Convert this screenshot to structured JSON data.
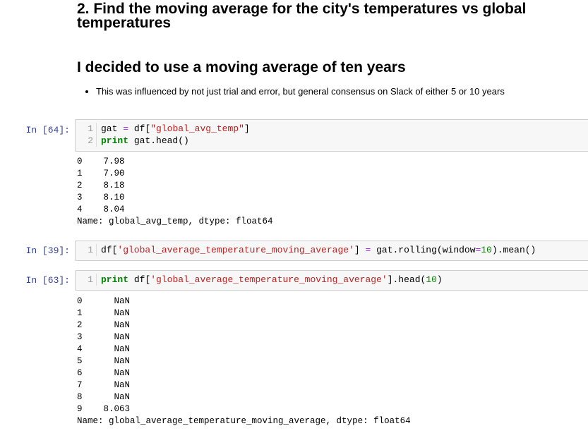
{
  "heading1": {
    "line1": "2. Find the moving average for the city's temperatures vs global",
    "line2": "temperatures"
  },
  "heading2": "I decided to use a moving average of ten years",
  "bullets": [
    "This was influenced by not just trial and error, but general consensus on Slack of either 5 or 10 years"
  ],
  "cells": {
    "cell1": {
      "prompt": "In [64]:",
      "lines": [
        {
          "num": "1",
          "parts": [
            {
              "t": "gat ",
              "c": ""
            },
            {
              "t": "=",
              "c": "op"
            },
            {
              "t": " df[",
              "c": ""
            },
            {
              "t": "\"global_avg_temp\"",
              "c": "str"
            },
            {
              "t": "]",
              "c": ""
            }
          ]
        },
        {
          "num": "2",
          "parts": [
            {
              "t": "print",
              "c": "kw"
            },
            {
              "t": " gat.head()",
              "c": ""
            }
          ]
        }
      ],
      "output": [
        "0    7.98",
        "1    7.90",
        "2    8.18",
        "3    8.10",
        "4    8.04",
        "Name: global_avg_temp, dtype: float64"
      ]
    },
    "cell2": {
      "prompt": "In [39]:",
      "lines": [
        {
          "num": "1",
          "parts": [
            {
              "t": "df[",
              "c": ""
            },
            {
              "t": "'global_average_temperature_moving_average'",
              "c": "str"
            },
            {
              "t": "] ",
              "c": ""
            },
            {
              "t": "=",
              "c": "op"
            },
            {
              "t": " gat.rolling(window",
              "c": ""
            },
            {
              "t": "=",
              "c": "op"
            },
            {
              "t": "10",
              "c": "num"
            },
            {
              "t": ").mean()",
              "c": ""
            }
          ]
        }
      ]
    },
    "cell3": {
      "prompt": "In [63]:",
      "lines": [
        {
          "num": "1",
          "parts": [
            {
              "t": "print",
              "c": "kw"
            },
            {
              "t": " df[",
              "c": ""
            },
            {
              "t": "'global_average_temperature_moving_average'",
              "c": "str"
            },
            {
              "t": "].head(",
              "c": ""
            },
            {
              "t": "10",
              "c": "num"
            },
            {
              "t": ")",
              "c": ""
            }
          ]
        }
      ],
      "output": [
        "0      NaN",
        "1      NaN",
        "2      NaN",
        "3      NaN",
        "4      NaN",
        "5      NaN",
        "6      NaN",
        "7      NaN",
        "8      NaN",
        "9    8.063",
        "Name: global_average_temperature_moving_average, dtype: float64"
      ]
    }
  }
}
